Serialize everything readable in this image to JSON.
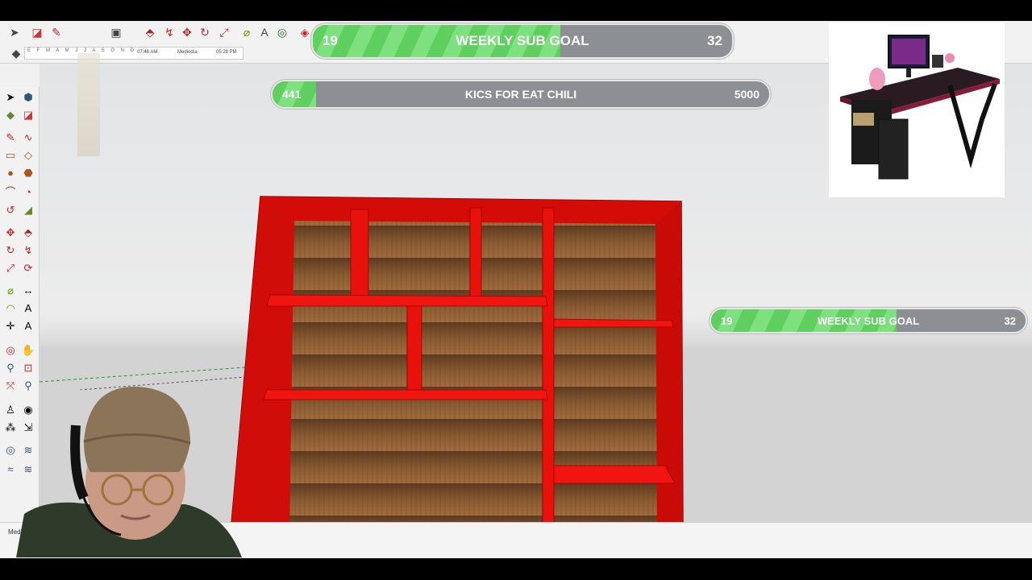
{
  "goals": {
    "top": {
      "current": "19",
      "label": "WEEKLY SUB GOAL",
      "target": "32",
      "progress": 0.59
    },
    "middle": {
      "current": "441",
      "label": "KICS FOR EAT CHILI",
      "target": "5000",
      "progress": 0.088
    },
    "right": {
      "current": "19",
      "label": "WEEKLY SUB GOAL",
      "target": "32",
      "progress": 0.59
    }
  },
  "timebar": {
    "months": "E F M A M J J A S O N D",
    "time_am": "07:48 AM",
    "time_mid": "Mediodía",
    "time_pm": "05:28 PM"
  },
  "status": {
    "measurements_label": "Medidas"
  },
  "colors": {
    "bookcase_red": "#e8120c",
    "wood": "#8a5a32",
    "goal_green": "#6fd86f"
  },
  "icons": {
    "top_toolbar": [
      "select-icon",
      "eraser-icon",
      "pencil-icon",
      "rectangle-icon",
      "paint-bucket-icon",
      "push-pull-icon",
      "follow-me-icon",
      "move-icon",
      "rotate-icon",
      "scale-icon",
      "tape-measure-icon",
      "text-icon",
      "orbit-icon",
      "section-icon"
    ],
    "left_toolbar": [
      "select-icon",
      "component-icon",
      "paint-bucket-icon",
      "eraser-icon",
      "pencil-icon",
      "freehand-icon",
      "rectangle-icon",
      "rotated-rectangle-icon",
      "circle-icon",
      "polygon-icon",
      "arc-icon",
      "pie-icon",
      "move-icon",
      "push-pull-icon",
      "rotate-icon",
      "follow-me-icon",
      "scale-icon",
      "offset-icon",
      "tape-measure-icon",
      "text-icon",
      "protractor-icon",
      "axes-icon",
      "orbit-icon",
      "pan-icon",
      "zoom-icon",
      "zoom-window-icon",
      "zoom-extents-icon",
      "zoom-previous-icon",
      "walk-icon",
      "look-around-icon",
      "footprints-icon",
      "position-camera-icon",
      "sandbox-icon",
      "smoove-icon",
      "stamp-icon",
      "drape-icon"
    ]
  }
}
